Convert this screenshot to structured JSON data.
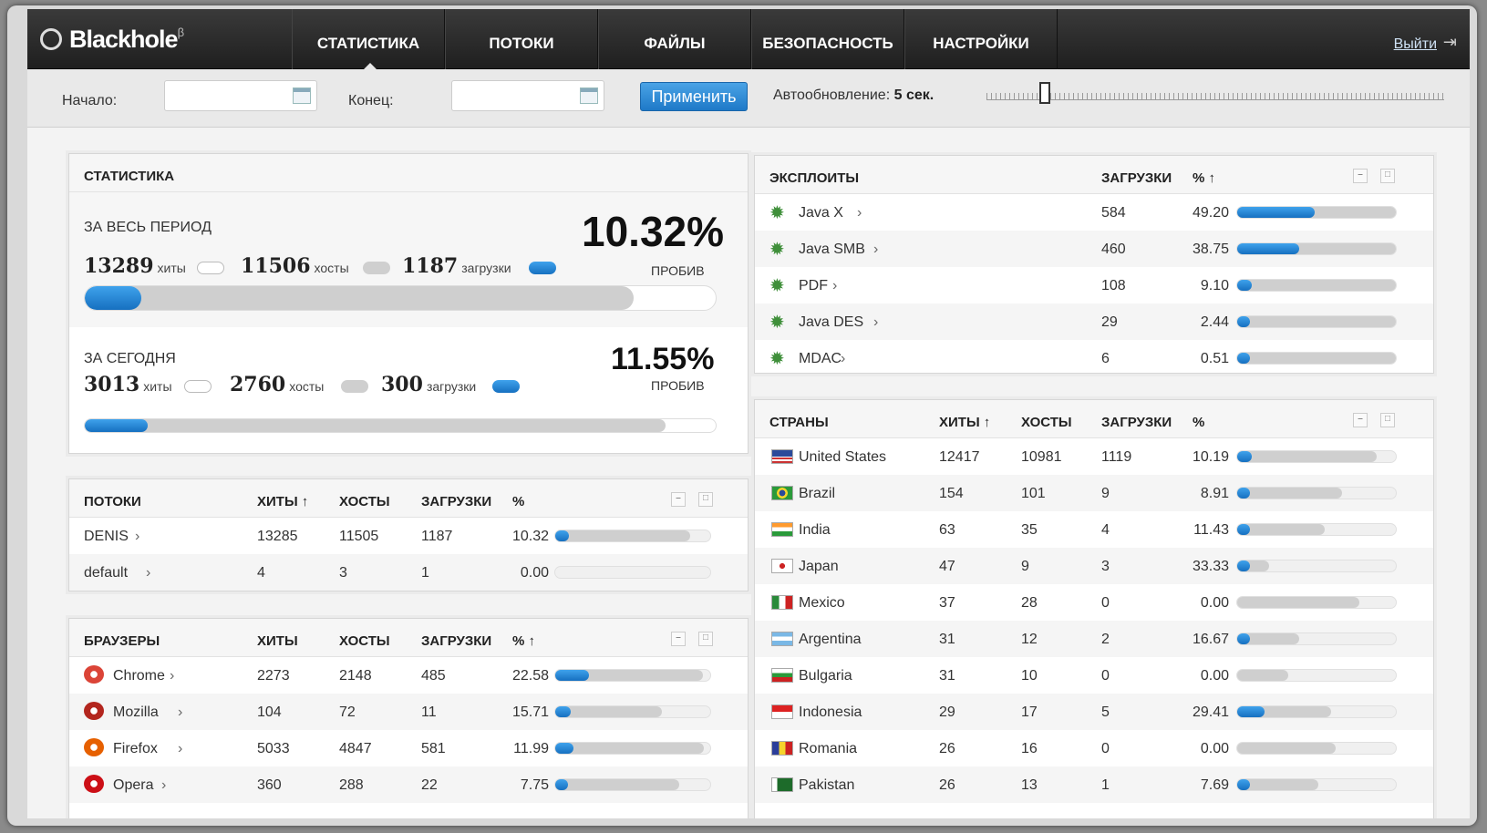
{
  "app": {
    "logo": "Blackhole",
    "logo_sup": "β"
  },
  "nav": [
    {
      "label": "СТАТИСТИКА",
      "active": true
    },
    {
      "label": "ПОТОКИ"
    },
    {
      "label": "ФАЙЛЫ"
    },
    {
      "label": "БЕЗОПАСНОСТЬ"
    },
    {
      "label": "НАСТРОЙКИ"
    }
  ],
  "logout": "Выйти",
  "filter": {
    "start_label": "Начало:",
    "end_label": "Конец:",
    "start_value": "",
    "end_value": "",
    "apply": "Применить",
    "auto_label": "Автообновление:",
    "auto_value": "5 сек."
  },
  "stats": {
    "title": "СТАТИСТИКА",
    "all_time": {
      "label": "ЗА ВЕСЬ ПЕРИОД",
      "hits": "13289",
      "hits_label": "хиты",
      "hosts": "11506",
      "hosts_label": "хосты",
      "loads": "1187",
      "loads_label": "загрузки",
      "rate": "10.32%",
      "rate_label": "ПРОБИВ",
      "hosts_fraction": 0.87,
      "loads_fraction": 0.09
    },
    "today": {
      "label": "ЗА СЕГОДНЯ",
      "hits": "3013",
      "hits_label": "хиты",
      "hosts": "2760",
      "hosts_label": "хосты",
      "loads": "300",
      "loads_label": "загрузки",
      "rate": "11.55%",
      "rate_label": "ПРОБИВ",
      "hosts_fraction": 0.92,
      "loads_fraction": 0.1
    }
  },
  "streams": {
    "title": "ПОТОКИ",
    "cols": [
      "ХИТЫ ↑",
      "ХОСТЫ",
      "ЗАГРУЗКИ",
      "%"
    ],
    "rows": [
      {
        "name": "DENIS",
        "hits": "13285",
        "hosts": "11505",
        "loads": "1187",
        "pct": "10.32",
        "gray": 0.87,
        "blue": 0.09
      },
      {
        "name": "default",
        "hits": "4",
        "hosts": "3",
        "loads": "1",
        "pct": "0.00",
        "gray": 0.0,
        "blue": 0.0
      }
    ]
  },
  "browsers": {
    "title": "БРАУЗЕРЫ",
    "cols": [
      "ХИТЫ",
      "ХОСТЫ",
      "ЗАГРУЗКИ",
      "% ↑"
    ],
    "rows": [
      {
        "name": "Chrome",
        "icon": "chrome-icon",
        "hits": "2273",
        "hosts": "2148",
        "loads": "485",
        "pct": "22.58",
        "gray": 0.95,
        "blue": 0.22
      },
      {
        "name": "Mozilla",
        "icon": "mozilla-icon",
        "hits": "104",
        "hosts": "72",
        "loads": "11",
        "pct": "15.71",
        "gray": 0.69,
        "blue": 0.1
      },
      {
        "name": "Firefox",
        "icon": "firefox-icon",
        "hits": "5033",
        "hosts": "4847",
        "loads": "581",
        "pct": "11.99",
        "gray": 0.96,
        "blue": 0.12
      },
      {
        "name": "Opera",
        "icon": "opera-icon",
        "hits": "360",
        "hosts": "288",
        "loads": "22",
        "pct": "7.75",
        "gray": 0.8,
        "blue": 0.06
      }
    ]
  },
  "exploits": {
    "title": "ЭКСПЛОИТЫ",
    "cols": [
      "ЗАГРУЗКИ",
      "% ↑"
    ],
    "rows": [
      {
        "name": "Java X",
        "loads": "584",
        "pct": "49.20",
        "gray": 1.0,
        "blue": 0.49
      },
      {
        "name": "Java SMB",
        "loads": "460",
        "pct": "38.75",
        "gray": 1.0,
        "blue": 0.39
      },
      {
        "name": "PDF",
        "loads": "108",
        "pct": "9.10",
        "gray": 1.0,
        "blue": 0.09
      },
      {
        "name": "Java DES",
        "loads": "29",
        "pct": "2.44",
        "gray": 1.0,
        "blue": 0.02
      },
      {
        "name": "MDAC",
        "loads": "6",
        "pct": "0.51",
        "gray": 1.0,
        "blue": 0.01
      }
    ]
  },
  "countries": {
    "title": "СТРАНЫ",
    "cols": [
      "ХИТЫ ↑",
      "ХОСТЫ",
      "ЗАГРУЗКИ",
      "%"
    ],
    "rows": [
      {
        "name": "United States",
        "flag": "us",
        "hits": "12417",
        "hosts": "10981",
        "loads": "1119",
        "pct": "10.19",
        "gray": 0.88,
        "blue": 0.09
      },
      {
        "name": "Brazil",
        "flag": "br",
        "hits": "154",
        "hosts": "101",
        "loads": "9",
        "pct": "8.91",
        "gray": 0.66,
        "blue": 0.06
      },
      {
        "name": "India",
        "flag": "in",
        "hits": "63",
        "hosts": "35",
        "loads": "4",
        "pct": "11.43",
        "gray": 0.55,
        "blue": 0.06
      },
      {
        "name": "Japan",
        "flag": "jp",
        "hits": "47",
        "hosts": "9",
        "loads": "3",
        "pct": "33.33",
        "gray": 0.2,
        "blue": 0.07
      },
      {
        "name": "Mexico",
        "flag": "mx",
        "hits": "37",
        "hosts": "28",
        "loads": "0",
        "pct": "0.00",
        "gray": 0.77,
        "blue": 0.0
      },
      {
        "name": "Argentina",
        "flag": "ar",
        "hits": "31",
        "hosts": "12",
        "loads": "2",
        "pct": "16.67",
        "gray": 0.39,
        "blue": 0.06
      },
      {
        "name": "Bulgaria",
        "flag": "bg",
        "hits": "31",
        "hosts": "10",
        "loads": "0",
        "pct": "0.00",
        "gray": 0.32,
        "blue": 0.0
      },
      {
        "name": "Indonesia",
        "flag": "id",
        "hits": "29",
        "hosts": "17",
        "loads": "5",
        "pct": "29.41",
        "gray": 0.59,
        "blue": 0.17
      },
      {
        "name": "Romania",
        "flag": "ro",
        "hits": "26",
        "hosts": "16",
        "loads": "0",
        "pct": "0.00",
        "gray": 0.62,
        "blue": 0.0
      },
      {
        "name": "Pakistan",
        "flag": "pk",
        "hits": "26",
        "hosts": "13",
        "loads": "1",
        "pct": "7.69",
        "gray": 0.51,
        "blue": 0.04
      }
    ]
  },
  "colors": {
    "accent": "#1e79c8",
    "topbar": "#2a2a2a"
  }
}
